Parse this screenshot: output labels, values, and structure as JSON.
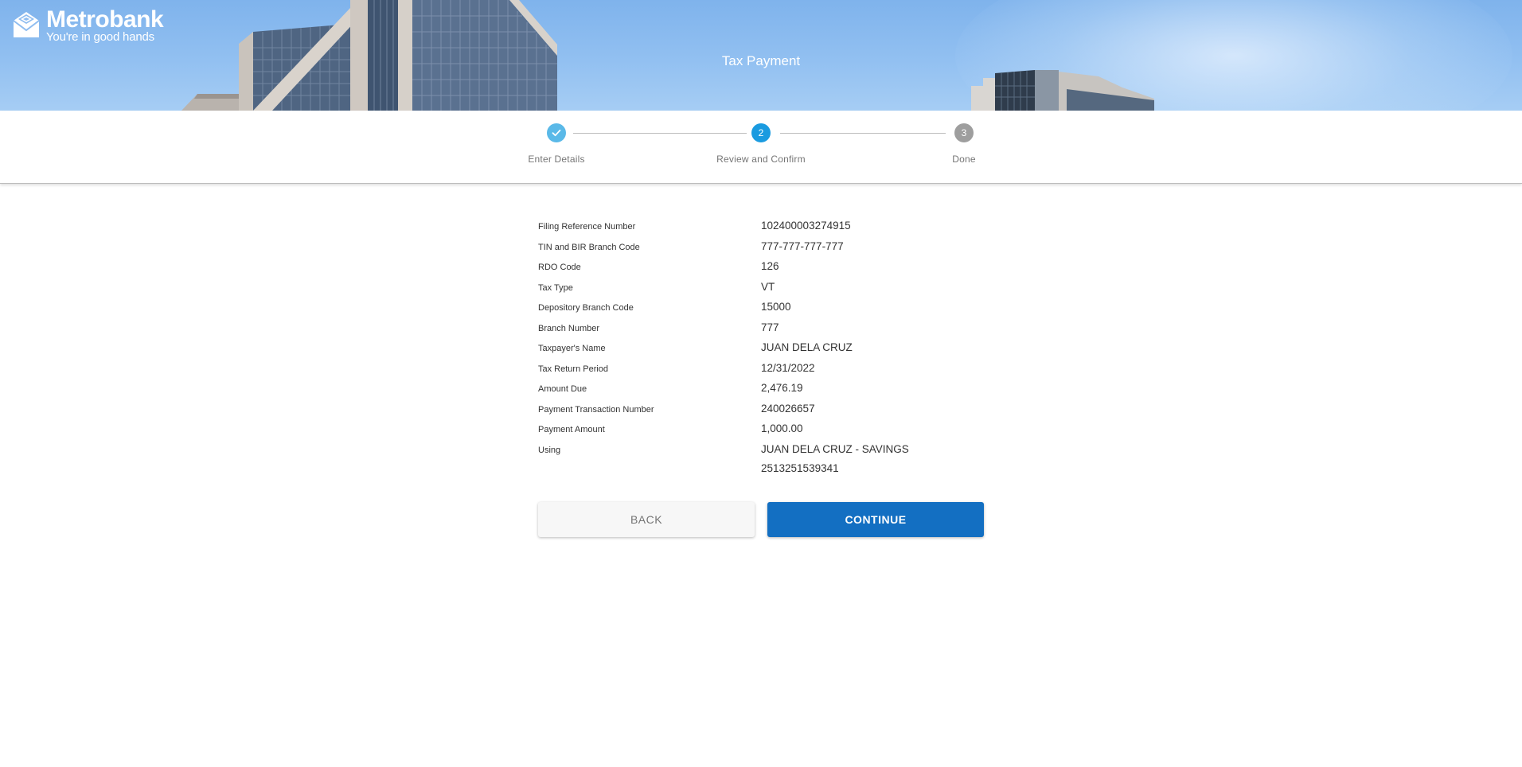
{
  "header": {
    "brand_name": "Metrobank",
    "tagline": "You're in good hands",
    "page_title": "Tax Payment",
    "logo_icon": "metrobank-logo-icon"
  },
  "stepper": {
    "steps": [
      {
        "label": "Enter Details",
        "marker": "✓",
        "state": "done"
      },
      {
        "label": "Review and Confirm",
        "marker": "2",
        "state": "active"
      },
      {
        "label": "Done",
        "marker": "3",
        "state": "pending"
      }
    ]
  },
  "details": [
    {
      "label": "Filing Reference Number",
      "value": "102400003274915"
    },
    {
      "label": "TIN and BIR Branch Code",
      "value": "777-777-777-777"
    },
    {
      "label": "RDO Code",
      "value": "126"
    },
    {
      "label": "Tax Type",
      "value": "VT"
    },
    {
      "label": "Depository Branch Code",
      "value": "15000"
    },
    {
      "label": "Branch Number",
      "value": "777"
    },
    {
      "label": "Taxpayer's Name",
      "value": "JUAN DELA CRUZ"
    },
    {
      "label": "Tax Return Period",
      "value": "12/31/2022"
    },
    {
      "label": "Amount Due",
      "value": "2,476.19"
    },
    {
      "label": "Payment Transaction Number",
      "value": "240026657"
    },
    {
      "label": "Payment Amount",
      "value": "1,000.00"
    },
    {
      "label": "Using",
      "value": "JUAN DELA CRUZ - SAVINGS",
      "value_line2": "2513251539341"
    }
  ],
  "actions": {
    "back_label": "BACK",
    "continue_label": "CONTINUE"
  },
  "colors": {
    "primary": "#136fc2",
    "step_active": "#1a9be0",
    "step_done": "#5ab9e8",
    "step_pending": "#9e9e9e"
  }
}
